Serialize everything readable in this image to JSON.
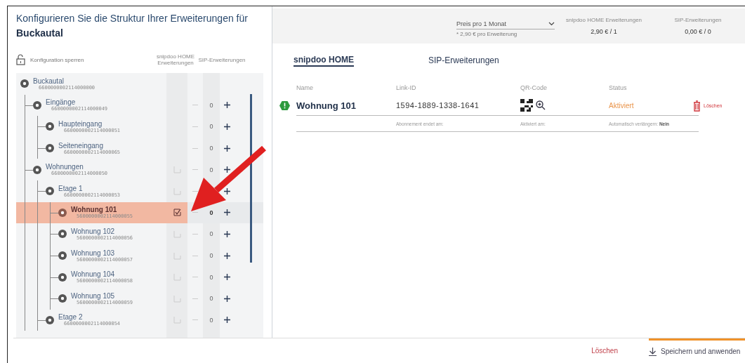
{
  "title": "Konfigurieren Sie die Struktur Ihrer Erweiterungen für",
  "title_bold": "Buckautal",
  "lock": {
    "label": "Konfiguration sperren"
  },
  "tree_columns": [
    "snipdoo HOME Erweiterungen",
    "SIP-Erweiterungen"
  ],
  "tree": [
    {
      "name": "Buckautal",
      "id": "6600000002114000000",
      "selected": false,
      "children": [
        {
          "name": "Eingänge",
          "id": "6600000002114000049",
          "count": "0",
          "selected": false,
          "children": [
            {
              "name": "Haupteingang",
              "id": "6600000002114000051",
              "count": "0",
              "selected": false
            },
            {
              "name": "Seiteneingang",
              "id": "6600000002114000065",
              "count": "0",
              "selected": false
            }
          ]
        },
        {
          "name": "Wohnungen",
          "id": "6600000002114000050",
          "checked": false,
          "count": "0",
          "selected": false,
          "children": [
            {
              "name": "Etage 1",
              "id": "6600000002114000053",
              "checked": false,
              "selected": false,
              "children": [
                {
                  "name": "Wohnung 101",
                  "id": "5600000002114000055",
                  "checked": true,
                  "count": "0",
                  "selected": true
                },
                {
                  "name": "Wohnung 102",
                  "id": "5600000002114000056",
                  "checked": false,
                  "count": "0",
                  "selected": false
                },
                {
                  "name": "Wohnung 103",
                  "id": "5600000002114000057",
                  "checked": false,
                  "count": "0",
                  "selected": false
                },
                {
                  "name": "Wohnung 104",
                  "id": "5600000002114000058",
                  "checked": false,
                  "count": "0",
                  "selected": false
                },
                {
                  "name": "Wohnung 105",
                  "id": "5600000002114000059",
                  "checked": false,
                  "count": "0",
                  "selected": false
                }
              ]
            },
            {
              "name": "Etage 2",
              "id": "6600000002114000054",
              "checked": false,
              "count": "0",
              "selected": false
            }
          ]
        }
      ]
    }
  ],
  "pricing": {
    "period": {
      "value": "Preis pro 1 Monat",
      "hint": "* 2,90 € pro Erweiterung"
    },
    "totals": [
      {
        "label": "snipdoo HOME Erweiterungen",
        "value": "2,90 € / 1"
      },
      {
        "label": "SIP-Erweiterungen",
        "value": "0,00 € / 0"
      }
    ]
  },
  "tabs": [
    {
      "label": "snipdoo HOME",
      "selected": true
    },
    {
      "label": "SIP-Erweiterungen",
      "selected": false
    }
  ],
  "table": {
    "columns": [
      "Name",
      "Link-ID",
      "QR-Code",
      "Status"
    ],
    "rows": [
      {
        "name": "Wohnung 101",
        "link_id": "1594-1889-1338-1641",
        "status": "Aktiviert",
        "delete": "Löschen",
        "ends": "Abonnement endet am:",
        "activated": "Aktiviert am:",
        "renew": "Automatisch verlängern: **Nein**"
      }
    ]
  },
  "footer": {
    "delete": "Löschen",
    "save": "Speichern und anwenden"
  }
}
